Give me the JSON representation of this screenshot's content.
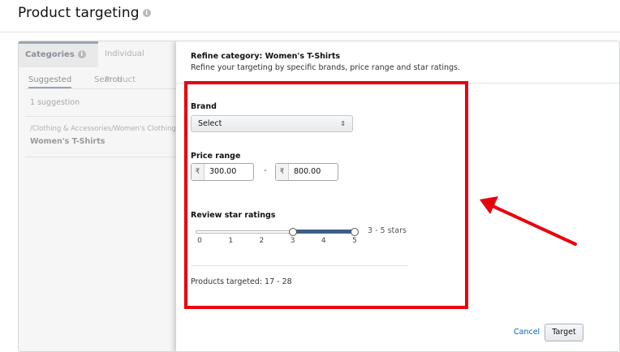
{
  "header": {
    "title": "Product targeting"
  },
  "left_panel": {
    "tabs": [
      {
        "label": "Categories"
      },
      {
        "label": "Individual Product"
      }
    ],
    "subtabs": [
      {
        "label": "Suggested"
      },
      {
        "label": "Search"
      }
    ],
    "suggestion_count": "1 suggestion",
    "suggestion": {
      "path": "/Clothing & Accessories/Women's Clothing/W",
      "name": "Women's T-Shirts"
    }
  },
  "modal": {
    "title": "Refine category: Women's T-Shirts",
    "subtitle": "Refine your targeting by specific brands, price range and star ratings.",
    "brand": {
      "label": "Brand",
      "selected": "Select"
    },
    "price_range": {
      "label": "Price range",
      "currency_symbol": "₹",
      "min": "300.00",
      "max": "800.00",
      "separator": "-"
    },
    "review": {
      "label": "Review star ratings",
      "ticks": [
        "0",
        "1",
        "2",
        "3",
        "4",
        "5"
      ],
      "range_min": 3,
      "range_max": 5,
      "range_label": "3 - 5 stars"
    },
    "products_targeted": "Products targeted: 17 - 28",
    "actions": {
      "cancel": "Cancel",
      "target": "Target"
    }
  },
  "colors": {
    "accent": "#3d5f86",
    "link": "#0066c0",
    "highlight": "#e8000e"
  },
  "icons": {
    "info": "info-icon",
    "select_arrow": "select-arrow-icon",
    "annotation": "arrow-annotation-icon"
  }
}
